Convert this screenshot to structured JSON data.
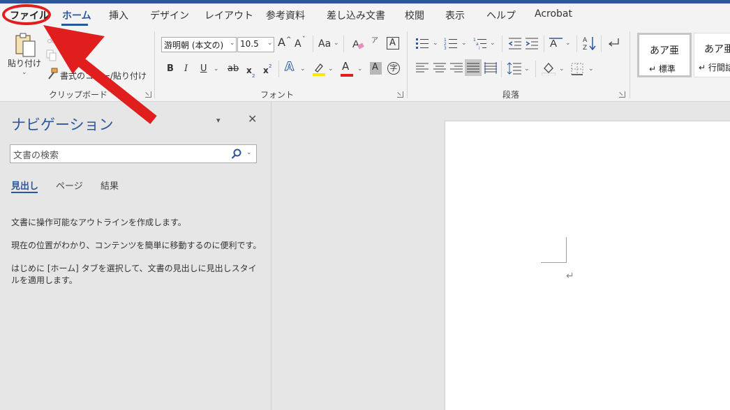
{
  "ribbon_tabs": [
    "ファイル",
    "ホーム",
    "挿入",
    "デザイン",
    "レイアウト",
    "参考資料",
    "差し込み文書",
    "校閲",
    "表示",
    "ヘルプ",
    "Acrobat"
  ],
  "clipboard": {
    "paste_label": "貼り付け",
    "format_painter_label": "書式のコピー/貼り付け",
    "group_label": "クリップボード"
  },
  "font": {
    "name": "游明朝 (本文の)",
    "size": "10.5",
    "grow_label": "A",
    "shrink_label": "A",
    "case_label": "Aa",
    "bold": "B",
    "italic": "I",
    "underline": "U",
    "strikethrough": "ab",
    "subscript": "x",
    "superscript": "x",
    "text_effects": "A",
    "font_color": "A",
    "char_shading": "A",
    "enclose": "字",
    "phonetic": "ア",
    "group_label": "フォント"
  },
  "paragraph": {
    "group_label": "段落"
  },
  "styles": [
    {
      "sample": "あア亜",
      "name": "↵ 標準"
    },
    {
      "sample": "あア亜",
      "name": "↵ 行間詰"
    }
  ],
  "navigation": {
    "title": "ナビゲーション",
    "search_placeholder": "文書の検索",
    "tabs": [
      "見出し",
      "ページ",
      "結果"
    ],
    "messages": [
      "文書に操作可能なアウトラインを作成します。",
      "現在の位置がわかり、コンテンツを簡単に移動するのに便利です。",
      "はじめに [ホーム] タブを選択して、文書の見出しに見出しスタイルを適用します。"
    ]
  },
  "document": {
    "paragraph_mark": "↵"
  },
  "colors": {
    "accent": "#2b579a",
    "highlight_yellow": "#ffe600",
    "font_red": "#e02020",
    "annotation_red": "#e01e1e"
  }
}
